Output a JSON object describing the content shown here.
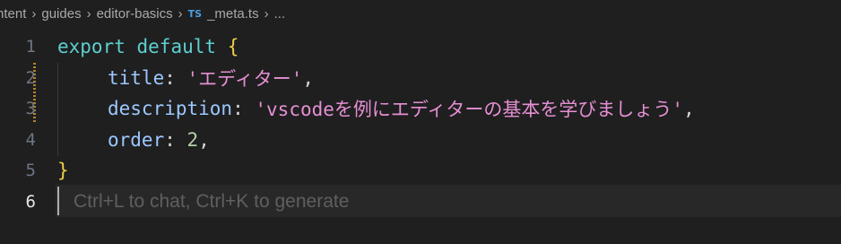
{
  "breadcrumb": {
    "items": [
      "ntent",
      "guides",
      "editor-basics"
    ],
    "file_badge": "TS",
    "file_name": "_meta.ts",
    "trailing": "..."
  },
  "code": {
    "line_numbers": [
      "1",
      "2",
      "3",
      "4",
      "5",
      "6"
    ],
    "active_line": "6",
    "line1": {
      "keyword1": "export",
      "keyword2": "default",
      "brace": "{"
    },
    "line2": {
      "key": "title",
      "colon": ":",
      "value": "'エディター'",
      "comma": ","
    },
    "line3": {
      "key": "description",
      "colon": ":",
      "value": "'vscodeを例にエディターの基本を学びましょう'",
      "comma": ","
    },
    "line4": {
      "key": "order",
      "colon": ":",
      "value": "2",
      "comma": ","
    },
    "line5": {
      "brace": "}"
    }
  },
  "inline_hint": "Ctrl+L to chat, Ctrl+K to generate",
  "colors": {
    "background": "#1f1f1f",
    "keyword": "#5ecfcf",
    "brace": "#f2cf47",
    "property": "#9cc8ff",
    "string": "#e58fd3",
    "number": "#b5cea8",
    "line_number": "#6e7681",
    "modified_marker": "#b3822a"
  }
}
